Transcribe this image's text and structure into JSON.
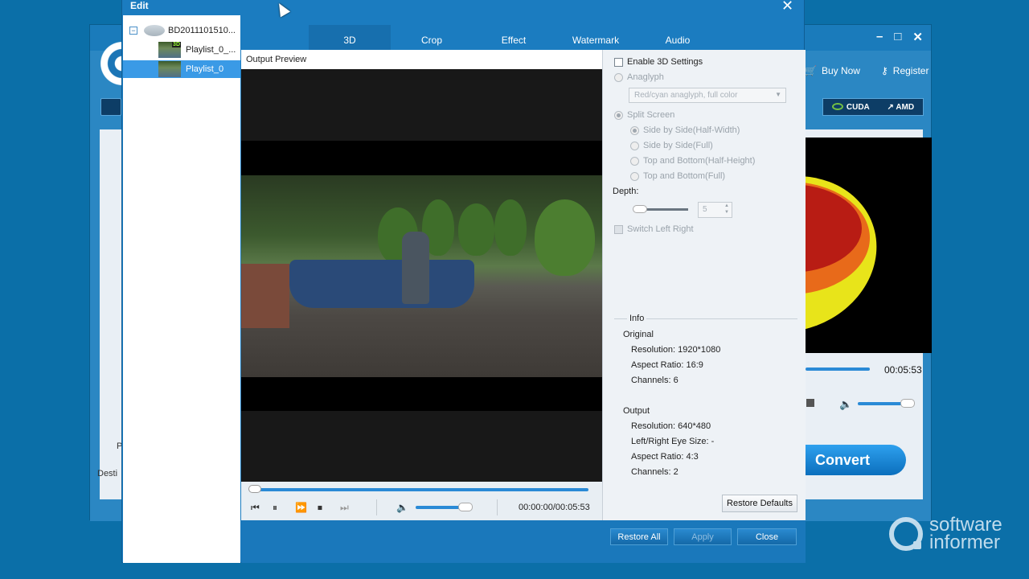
{
  "background_app": {
    "toolbar": {
      "buy_now": "Buy Now",
      "register": "Register"
    },
    "gpu": {
      "cuda": "CUDA",
      "amd": "AMD"
    },
    "duration": "00:05:53",
    "convert_label": "Convert",
    "side_label_p": "P",
    "side_label_dest": "Desti"
  },
  "dialog": {
    "title": "Edit",
    "tree": [
      {
        "label": "BD2011101510...",
        "selected": false
      },
      {
        "label": "Playlist_0_...",
        "selected": false
      },
      {
        "label": "Playlist_0",
        "selected": true
      }
    ],
    "tabs": [
      {
        "label": "3D",
        "active": true
      },
      {
        "label": "Crop",
        "active": false
      },
      {
        "label": "Effect",
        "active": false
      },
      {
        "label": "Watermark",
        "active": false
      },
      {
        "label": "Audio",
        "active": false
      }
    ],
    "output_preview_label": "Output Preview",
    "player": {
      "time": "00:00:00/00:05:53",
      "volume_level": 0.85
    },
    "settings": {
      "enable_3d": "Enable 3D Settings",
      "anaglyph": "Anaglyph",
      "anaglyph_option": "Red/cyan anaglyph, full color",
      "split_screen": "Split Screen",
      "sbs_half": "Side by Side(Half-Width)",
      "sbs_full": "Side by Side(Full)",
      "tb_half": "Top and Bottom(Half-Height)",
      "tb_full": "Top and Bottom(Full)",
      "depth_label": "Depth:",
      "depth_value": "5",
      "switch_lr": "Switch Left Right"
    },
    "info": {
      "legend": "Info",
      "original_label": "Original",
      "original_resolution": "Resolution: 1920*1080",
      "original_aspect": "Aspect Ratio: 16:9",
      "original_channels": "Channels: 6",
      "output_label": "Output",
      "output_resolution": "Resolution: 640*480",
      "output_eye": "Left/Right Eye Size: -",
      "output_aspect": "Aspect Ratio: 4:3",
      "output_channels": "Channels: 2"
    },
    "restore_defaults": "Restore Defaults",
    "footer": {
      "restore_all": "Restore All",
      "apply": "Apply",
      "close": "Close"
    }
  },
  "watermark": {
    "line1": "software",
    "line2": "informer"
  }
}
